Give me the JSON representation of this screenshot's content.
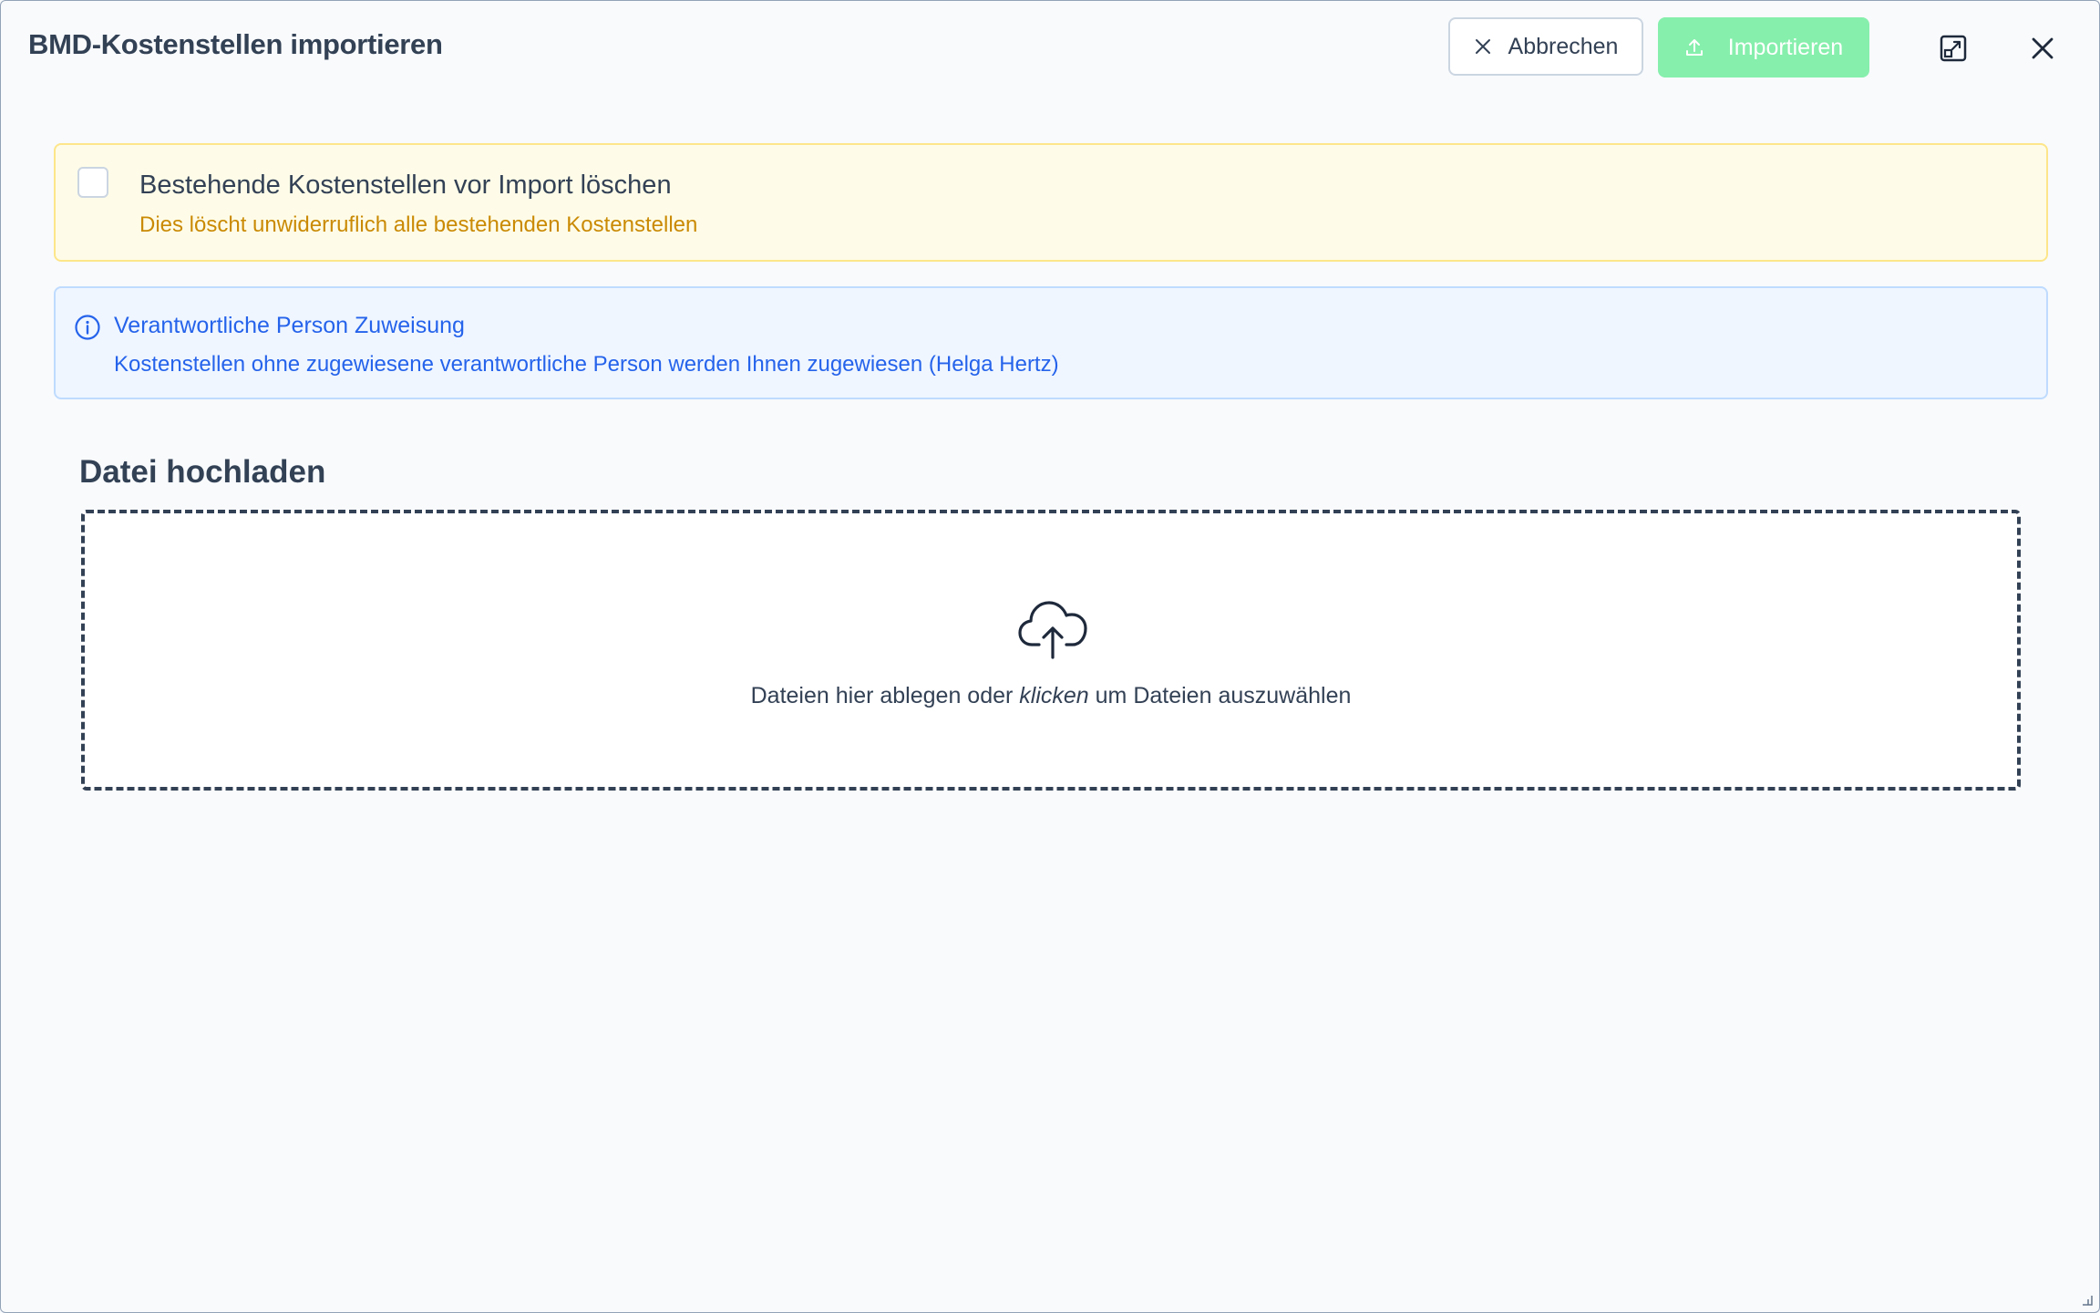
{
  "dialog": {
    "title": "BMD-Kostenstellen importieren",
    "cancel_label": "Abbrechen",
    "import_label": "Importieren",
    "icons": {
      "cancel": "close-icon",
      "import": "upload-icon",
      "expand": "expand-window-icon",
      "close": "close-icon"
    }
  },
  "warning": {
    "checkbox_checked": false,
    "label": "Bestehende Kostenstellen vor Import löschen",
    "description": "Dies löscht unwiderruflich alle bestehenden Kostenstellen"
  },
  "info": {
    "title": "Verantwortliche Person Zuweisung",
    "text": "Kostenstellen ohne zugewiesene verantwortliche Person werden Ihnen zugewiesen (Helga Hertz)"
  },
  "upload": {
    "section_title": "Datei hochladen",
    "text_before": "Dateien hier ablegen oder ",
    "text_emphasis": "klicken",
    "text_after": " um Dateien auszuwählen",
    "icon": "cloud-upload-icon"
  },
  "colors": {
    "primary_disabled": "#86efac",
    "warning_text": "#ca8a04",
    "info_text": "#2563eb"
  }
}
